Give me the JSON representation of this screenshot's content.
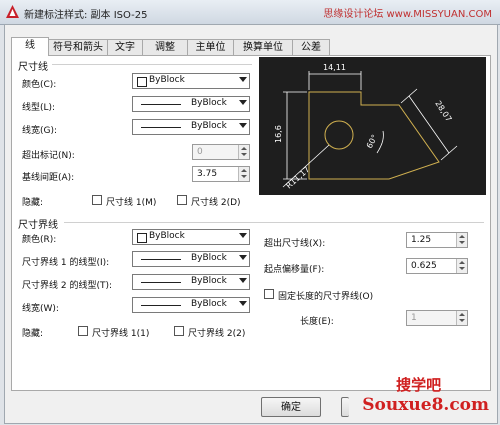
{
  "window": {
    "title": "新建标注样式: 副本 ISO-25",
    "watermark": "思缘设计论坛 www.MISSYUAN.COM"
  },
  "tabs": [
    "线",
    "符号和箭头",
    "文字",
    "调整",
    "主单位",
    "换算单位",
    "公差"
  ],
  "dim_lines": {
    "section": "尺寸线",
    "color_label": "颜色(C):",
    "color_value": "ByBlock",
    "linetype_label": "线型(L):",
    "linetype_value": "ByBlock",
    "lineweight_label": "线宽(G):",
    "lineweight_value": "ByBlock",
    "extend_label": "超出标记(N):",
    "extend_value": "0",
    "baseline_label": "基线间距(A):",
    "baseline_value": "3.75",
    "suppress_label": "隐藏:",
    "suppress1": "尺寸线 1(M)",
    "suppress2": "尺寸线 2(D)"
  },
  "ext_lines": {
    "section": "尺寸界线",
    "color_label": "颜色(R):",
    "color_value": "ByBlock",
    "linetype1_label": "尺寸界线 1 的线型(I):",
    "linetype1_value": "ByBlock",
    "linetype2_label": "尺寸界线 2 的线型(T):",
    "linetype2_value": "ByBlock",
    "lineweight_label": "线宽(W):",
    "lineweight_value": "ByBlock",
    "suppress_label": "隐藏:",
    "suppress1": "尺寸界线 1(1)",
    "suppress2": "尺寸界线 2(2)",
    "extend_label": "超出尺寸线(X):",
    "extend_value": "1.25",
    "offset_label": "起点偏移量(F):",
    "offset_value": "0.625",
    "fixed_label": "固定长度的尺寸界线(O)",
    "length_label": "长度(E):",
    "length_value": "1"
  },
  "preview": {
    "dim_top": "14,11",
    "dim_left": "16,6",
    "dim_right": "28,07",
    "dim_angle": "60°",
    "dim_radius": "R11,17"
  },
  "buttons": {
    "ok": "确定"
  },
  "brand": {
    "top": "搜学吧",
    "bottom": "Souxue8.com"
  },
  "colors": {
    "preview_bg": "#1e1e1e",
    "geometry": "#d0b050",
    "dimension": "#ffffff",
    "brand": "#d02020"
  }
}
